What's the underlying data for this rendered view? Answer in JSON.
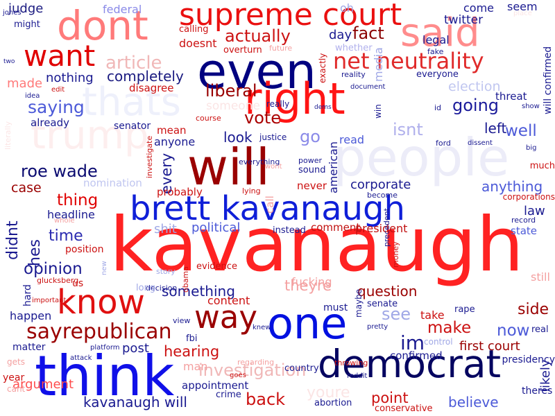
{
  "words": [
    {
      "text": "kavanaugh",
      "color": "#ff2222"
    },
    {
      "text": "people",
      "color": "#ececf8"
    },
    {
      "text": "even",
      "color": "#000080"
    },
    {
      "text": "think",
      "color": "#1010e8"
    },
    {
      "text": "will",
      "color": "#9a0000"
    },
    {
      "text": "one",
      "color": "#0010e0"
    },
    {
      "text": "dont",
      "color": "#ff7a7a"
    },
    {
      "text": "said",
      "color": "#ff8c8c"
    },
    {
      "text": "right",
      "color": "#ff1414"
    },
    {
      "text": "supreme court",
      "color": "#ea1010"
    },
    {
      "text": "thats",
      "color": "#eef0fb"
    },
    {
      "text": "trump",
      "color": "#fdeeee"
    },
    {
      "text": "brett kavanaugh",
      "color": "#0f1fd8"
    },
    {
      "text": "democrat",
      "color": "#050560"
    },
    {
      "text": "know",
      "color": "#e01010"
    },
    {
      "text": "want",
      "color": "#e00000"
    },
    {
      "text": "way",
      "color": "#9a0000"
    },
    {
      "text": "net neutrality",
      "color": "#e02a2a"
    },
    {
      "text": "sayrepublican",
      "color": "#9a0000"
    },
    {
      "text": "article",
      "color": "#f0b7b7"
    },
    {
      "text": "actually",
      "color": "#cc1111"
    },
    {
      "text": "fact",
      "color": "#8a0000"
    },
    {
      "text": "liberal",
      "color": "#990000"
    },
    {
      "text": "vote",
      "color": "#aa0000"
    },
    {
      "text": "going",
      "color": "#1a1a9a"
    },
    {
      "text": "saying",
      "color": "#4c5ad8"
    },
    {
      "text": "completely",
      "color": "#1a1a80"
    },
    {
      "text": "roe wade",
      "color": "#0a0a70"
    },
    {
      "text": "thing",
      "color": "#e00000"
    },
    {
      "text": "case",
      "color": "#9a0000"
    },
    {
      "text": "time",
      "color": "#2a2ab0"
    },
    {
      "text": "opinion",
      "color": "#1a1a90"
    },
    {
      "text": "didnt",
      "color": "#1a1a90"
    },
    {
      "text": "hes",
      "color": "#1a1a90"
    },
    {
      "text": "every",
      "color": "#1a1a90"
    },
    {
      "text": "look",
      "color": "#1a1a90"
    },
    {
      "text": "go",
      "color": "#8a8ae8"
    },
    {
      "text": "isnt",
      "color": "#b0b0ec"
    },
    {
      "text": "left",
      "color": "#1a1a90"
    },
    {
      "text": "well",
      "color": "#4c5ad8"
    },
    {
      "text": "election",
      "color": "#c0c6f0"
    },
    {
      "text": "threat",
      "color": "#1a1a90"
    },
    {
      "text": "corporate",
      "color": "#1a1a90"
    },
    {
      "text": "anything",
      "color": "#4c5ad8"
    },
    {
      "text": "law",
      "color": "#1a1a90"
    },
    {
      "text": "state",
      "color": "#4c5ad8"
    },
    {
      "text": "political",
      "color": "#4c5ad8"
    },
    {
      "text": "shit",
      "color": "#a0a8e6"
    },
    {
      "text": "comment",
      "color": "#c01010"
    },
    {
      "text": "president",
      "color": "#c01010"
    },
    {
      "text": "question",
      "color": "#9a0000"
    },
    {
      "text": "theyre",
      "color": "#f4a0a0"
    },
    {
      "text": "something",
      "color": "#1a1a90"
    },
    {
      "text": "see",
      "color": "#a0a8e6"
    },
    {
      "text": "side",
      "color": "#9a0000"
    },
    {
      "text": "make",
      "color": "#cc1111"
    },
    {
      "text": "now",
      "color": "#4c5ad8"
    },
    {
      "text": "im",
      "color": "#1a1a90"
    },
    {
      "text": "first court",
      "color": "#9a0000"
    },
    {
      "text": "confirmed",
      "color": "#1a1a90"
    },
    {
      "text": "post",
      "color": "#1a1a90"
    },
    {
      "text": "hearing",
      "color": "#cc1111"
    },
    {
      "text": "investigation",
      "color": "#f0b7b7"
    },
    {
      "text": "back",
      "color": "#cc1111"
    },
    {
      "text": "point",
      "color": "#cc1111"
    },
    {
      "text": "believe",
      "color": "#4c5ad8"
    },
    {
      "text": "youre",
      "color": "#fbe5e5"
    },
    {
      "text": "kavanaugh will",
      "color": "#1a1a90"
    },
    {
      "text": "argument",
      "color": "#ff4c4c"
    },
    {
      "text": "judge",
      "color": "#1a1a80"
    },
    {
      "text": "federal",
      "color": "#8a8ae8"
    },
    {
      "text": "come",
      "color": "#1a1a90"
    },
    {
      "text": "seem",
      "color": "#1a1a90"
    },
    {
      "text": "twitter",
      "color": "#1a1a90"
    },
    {
      "text": "legal",
      "color": "#1a1a90"
    },
    {
      "text": "day",
      "color": "#1a1a90"
    },
    {
      "text": "whether",
      "color": "#b0b0ec"
    },
    {
      "text": "nothing",
      "color": "#1a1a90"
    },
    {
      "text": "made",
      "color": "#ff7a7a"
    },
    {
      "text": "already",
      "color": "#1a1a90"
    },
    {
      "text": "senator",
      "color": "#1a1a90"
    },
    {
      "text": "mean",
      "color": "#cc1111"
    },
    {
      "text": "anyone",
      "color": "#1a1a90"
    },
    {
      "text": "justice",
      "color": "#1a1a90"
    },
    {
      "text": "read",
      "color": "#4c5ad8"
    },
    {
      "text": "headline",
      "color": "#1a1a90"
    },
    {
      "text": "position",
      "color": "#cc1111"
    },
    {
      "text": "never",
      "color": "#cc1111"
    },
    {
      "text": "american",
      "color": "#1a1a90"
    },
    {
      "text": "probably",
      "color": "#cc1111"
    },
    {
      "text": "call",
      "color": "#f4a0a0"
    },
    {
      "text": "nomination",
      "color": "#c0c6f0"
    },
    {
      "text": "happen",
      "color": "#1a1a90"
    },
    {
      "text": "matter",
      "color": "#1a1a90"
    },
    {
      "text": "year",
      "color": "#cc1111"
    },
    {
      "text": "fbi",
      "color": "#1a1a90"
    },
    {
      "text": "man",
      "color": "#f4a0a0"
    },
    {
      "text": "crime",
      "color": "#1a1a90"
    },
    {
      "text": "abortion",
      "color": "#1a1a90"
    },
    {
      "text": "appointment",
      "color": "#1a1a90"
    },
    {
      "text": "country",
      "color": "#1a1a90"
    },
    {
      "text": "fucking",
      "color": "#f4a0a0"
    },
    {
      "text": "content",
      "color": "#cc1111"
    },
    {
      "text": "must",
      "color": "#1a1a90"
    },
    {
      "text": "take",
      "color": "#cc1111"
    },
    {
      "text": "still",
      "color": "#f4a0a0"
    },
    {
      "text": "real",
      "color": "#1a1a90"
    },
    {
      "text": "likely",
      "color": "#1a1a90"
    },
    {
      "text": "theres",
      "color": "#1a1a90"
    },
    {
      "text": "conservative",
      "color": "#cc1111"
    },
    {
      "text": "will confirmed",
      "color": "#1a1a90"
    },
    {
      "text": "doesnt",
      "color": "#cc1111"
    },
    {
      "text": "calling",
      "color": "#cc1111"
    },
    {
      "text": "overturn",
      "color": "#cc1111"
    },
    {
      "text": "future",
      "color": "#f4a0a0"
    },
    {
      "text": "might",
      "color": "#1a1a90"
    },
    {
      "text": "oh",
      "color": "#a0a8e6"
    },
    {
      "text": "disagree",
      "color": "#cc1111"
    },
    {
      "text": "edit",
      "color": "#cc1111"
    },
    {
      "text": "idea",
      "color": "#1a1a90"
    },
    {
      "text": "really",
      "color": "#1a1a90"
    },
    {
      "text": "exactly",
      "color": "#cc1111"
    },
    {
      "text": "media",
      "color": "#a0a8e6"
    },
    {
      "text": "reality",
      "color": "#1a1a90"
    },
    {
      "text": "everyone",
      "color": "#1a1a90"
    },
    {
      "text": "fake",
      "color": "#1a1a90"
    },
    {
      "text": "document",
      "color": "#1a1a90"
    },
    {
      "text": "someone",
      "color": "#fbe5e5"
    },
    {
      "text": "course",
      "color": "#cc1111"
    },
    {
      "text": "dems",
      "color": "#1a1a90"
    },
    {
      "text": "win",
      "color": "#1a1a90"
    },
    {
      "text": "id",
      "color": "#1a1a90"
    },
    {
      "text": "show",
      "color": "#1a1a90"
    },
    {
      "text": "ford",
      "color": "#1a1a90"
    },
    {
      "text": "dissent",
      "color": "#1a1a90"
    },
    {
      "text": "big",
      "color": "#1a1a90"
    },
    {
      "text": "much",
      "color": "#cc1111"
    },
    {
      "text": "corporations",
      "color": "#cc1111"
    },
    {
      "text": "record",
      "color": "#1a1a90"
    },
    {
      "text": "two",
      "color": "#1a1a90"
    },
    {
      "text": "jones",
      "color": "#1a1a90"
    },
    {
      "text": "literally",
      "color": "#fbe5e5"
    },
    {
      "text": "investigate",
      "color": "#cc1111"
    },
    {
      "text": "everything",
      "color": "#1a1a90"
    },
    {
      "text": "wont",
      "color": "#f4a0a0"
    },
    {
      "text": "power",
      "color": "#1a1a90"
    },
    {
      "text": "sound",
      "color": "#1a1a90"
    },
    {
      "text": "lying",
      "color": "#cc1111"
    },
    {
      "text": "become",
      "color": "#1a1a90"
    },
    {
      "text": "instead",
      "color": "#1a1a90"
    },
    {
      "text": "whole",
      "color": "#f4a0a0"
    },
    {
      "text": "glucksberg",
      "color": "#cc1111"
    },
    {
      "text": "obama",
      "color": "#cc1111"
    },
    {
      "text": "evidence",
      "color": "#cc1111"
    },
    {
      "text": "story",
      "color": "#a0a8e6"
    },
    {
      "text": "decision",
      "color": "#1a1a90"
    },
    {
      "text": "long",
      "color": "#a0a8e6"
    },
    {
      "text": "new",
      "color": "#a0a8e6"
    },
    {
      "text": "us",
      "color": "#cc1111"
    },
    {
      "text": "hard",
      "color": "#1a1a90"
    },
    {
      "text": "important",
      "color": "#cc1111"
    },
    {
      "text": "senate",
      "color": "#1a1a90"
    },
    {
      "text": "rape",
      "color": "#1a1a90"
    },
    {
      "text": "view",
      "color": "#1a1a90"
    },
    {
      "text": "knew",
      "color": "#1a1a90"
    },
    {
      "text": "maybe",
      "color": "#1a1a90"
    },
    {
      "text": "pretty",
      "color": "#1a1a90"
    },
    {
      "text": "control",
      "color": "#a0a8e6"
    },
    {
      "text": "attack",
      "color": "#1a1a90"
    },
    {
      "text": "platform",
      "color": "#1a1a90"
    },
    {
      "text": "throwing",
      "color": "#cc1111"
    },
    {
      "text": "reddit",
      "color": "#1a1a90"
    },
    {
      "text": "regarding",
      "color": "#f4a0a0"
    },
    {
      "text": "goes",
      "color": "#cc1111"
    },
    {
      "text": "gets",
      "color": "#f4a0a0"
    },
    {
      "text": "cant",
      "color": "#f4a0a0"
    },
    {
      "text": "presidency",
      "color": "#1a1a90"
    },
    {
      "text": "precedent",
      "color": "#1a1a90"
    },
    {
      "text": "money",
      "color": "#cc1111"
    },
    {
      "text": "place",
      "color": "#fbe5e5"
    }
  ]
}
